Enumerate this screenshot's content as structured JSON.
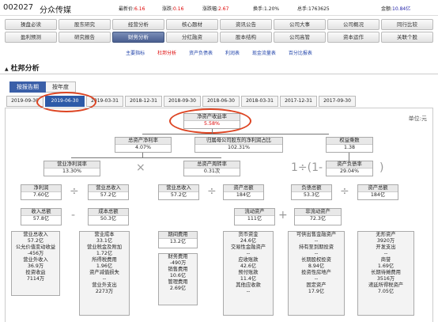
{
  "header": {
    "code": "002027",
    "name": "分众传媒",
    "quote": {
      "price_label": "最新价:",
      "price": "6.16",
      "chg_label": "涨跌:",
      "chg": "0.16",
      "pct_label": "涨跌幅:",
      "pct": "2.67",
      "turnover_label": "换手:",
      "turnover": "1.20%",
      "vol_label": "总手:",
      "vol": "1763625",
      "amt_label": "金额:",
      "amt": "10.84亿"
    }
  },
  "nav_row1": [
    "操盘必读",
    "股东研究",
    "经营分析",
    "核心题材",
    "资讯公告",
    "公司大事",
    "公司概况",
    "同行比较"
  ],
  "nav_row2": [
    "盈利预测",
    "研究报告",
    "财务分析",
    "分红融资",
    "股本结构",
    "公司高管",
    "资本运作",
    "关联个股"
  ],
  "sub_links": [
    "主要指标",
    "杜邦分析",
    "资产负债表",
    "利润表",
    "现金流量表",
    "百分比报表"
  ],
  "section_title": "杜邦分析",
  "report_tabs": [
    "按报告期",
    "按年度"
  ],
  "date_tabs": [
    "2019-09-30",
    "2019-06-30",
    "2019-03-31",
    "2018-12-31",
    "2018-09-30",
    "2018-06-30",
    "2018-03-31",
    "2017-12-31",
    "2017-09-30"
  ],
  "unit": "单位:元",
  "operators": {
    "times": "×",
    "plus": "+",
    "minus": "-",
    "div": "÷",
    "tiv_div": "1÷(1-"
  },
  "tree": {
    "roe": {
      "label": "净资产收益率",
      "value": "5.58%"
    },
    "roa": {
      "label": "总资产净利率",
      "value": "4.07%"
    },
    "parent_ratio": {
      "label": "归属母公司股东的净利润占比",
      "value": "102.31%"
    },
    "equity_mult": {
      "label": "权益乘数",
      "value": "1.38"
    },
    "net_margin": {
      "label": "营业净利润率",
      "value": "13.30%"
    },
    "asset_turn": {
      "label": "总资产周转率",
      "value": "0.31次"
    },
    "debt_ratio": {
      "label": "资产负债率",
      "value": "29.04%"
    },
    "net_profit": {
      "label": "净利润",
      "value": "7.60亿"
    },
    "revenue1": {
      "label": "营业总收入",
      "value": "57.2亿"
    },
    "revenue2": {
      "label": "营业总收入",
      "value": "57.2亿"
    },
    "total_assets1": {
      "label": "资产总额",
      "value": "184亿"
    },
    "total_liab": {
      "label": "负债总额",
      "value": "53.3亿"
    },
    "total_assets2": {
      "label": "资产总额",
      "value": "184亿"
    },
    "total_income": {
      "label": "收入总额",
      "value": "57.8亿"
    },
    "total_cost": {
      "label": "成本总额",
      "value": "50.3亿"
    },
    "current_assets": {
      "label": "流动资产",
      "value": "111亿"
    },
    "noncurrent_assets": {
      "label": "非流动资产",
      "value": "72.3亿"
    }
  },
  "income_items": [
    [
      "营业总收入",
      "57.2亿"
    ],
    [
      "公允价值变动收益",
      "-456万"
    ],
    [
      "营业外收入",
      "36.9万"
    ],
    [
      "投资收益",
      "7114万"
    ]
  ],
  "cost_items": [
    [
      "营业成本",
      "33.1亿"
    ],
    [
      "营业税金及附加",
      "1.72亿"
    ],
    [
      "所得税费用",
      "1.96亿"
    ],
    [
      "资产减值损失",
      "--"
    ],
    [
      "营业外支出",
      "2273万"
    ]
  ],
  "expense_items": [
    [
      "期间费用",
      "13.2亿"
    ]
  ],
  "expense_sub": [
    [
      "财务费用",
      "-490万"
    ],
    [
      "销售费用",
      "10.6亿"
    ],
    [
      "管理费用",
      "2.69亿"
    ]
  ],
  "current_items": [
    [
      "货币资金",
      "24.6亿"
    ],
    [
      "交易性金融资产",
      "--"
    ],
    [
      "应收账款",
      "42.6亿"
    ],
    [
      "预付账款",
      "11.4亿"
    ],
    [
      "其他应收款",
      "--"
    ]
  ],
  "noncurrent_items1": [
    [
      "可供出售金融资产",
      "--"
    ],
    [
      "持有至到期投资",
      "--"
    ],
    [
      "长期股权投资",
      "8.94亿"
    ],
    [
      "投资性房地产",
      "--"
    ],
    [
      "固定资产",
      "17.9亿"
    ]
  ],
  "noncurrent_items2": [
    [
      "无形资产",
      "3920万"
    ],
    [
      "开发支出",
      "--"
    ],
    [
      "商誉",
      "1.69亿"
    ],
    [
      "长期待摊费用",
      "3516万"
    ],
    [
      "递延所得税资产",
      "7.05亿"
    ]
  ]
}
